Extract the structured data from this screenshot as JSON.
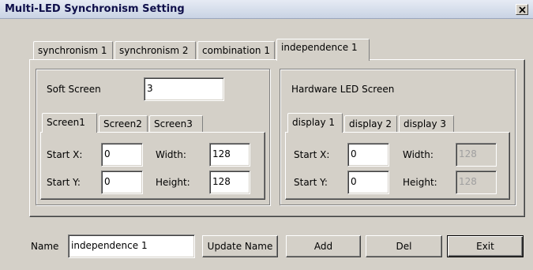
{
  "window": {
    "title": "Multi-LED Synchronism Setting"
  },
  "main_tabs": [
    {
      "label": "synchronism 1"
    },
    {
      "label": "synchronism 2"
    },
    {
      "label": "combination 1"
    },
    {
      "label": "independence 1",
      "active": true
    }
  ],
  "soft_screen": {
    "label": "Soft Screen",
    "value": "3",
    "tabs": [
      {
        "label": "Screen1",
        "active": true
      },
      {
        "label": "Screen2"
      },
      {
        "label": "Screen3"
      }
    ],
    "start_x_label": "Start X:",
    "start_x": "0",
    "start_y_label": "Start Y:",
    "start_y": "0",
    "width_label": "Width:",
    "width": "128",
    "height_label": "Height:",
    "height": "128"
  },
  "hardware_screen": {
    "label": "Hardware LED Screen",
    "tabs": [
      {
        "label": "display 1",
        "active": true
      },
      {
        "label": "display 2"
      },
      {
        "label": "display 3"
      }
    ],
    "start_x_label": "Start X:",
    "start_x": "0",
    "start_y_label": "Start Y:",
    "start_y": "0",
    "width_label": "Width:",
    "width": "128",
    "width_disabled": true,
    "height_label": "Height:",
    "height": "128",
    "height_disabled": true
  },
  "bottom": {
    "name_label": "Name",
    "name_value": "independence 1",
    "update_label": "Update Name",
    "add_label": "Add",
    "del_label": "Del",
    "exit_label": "Exit"
  },
  "icons": {
    "close": "close-icon"
  }
}
